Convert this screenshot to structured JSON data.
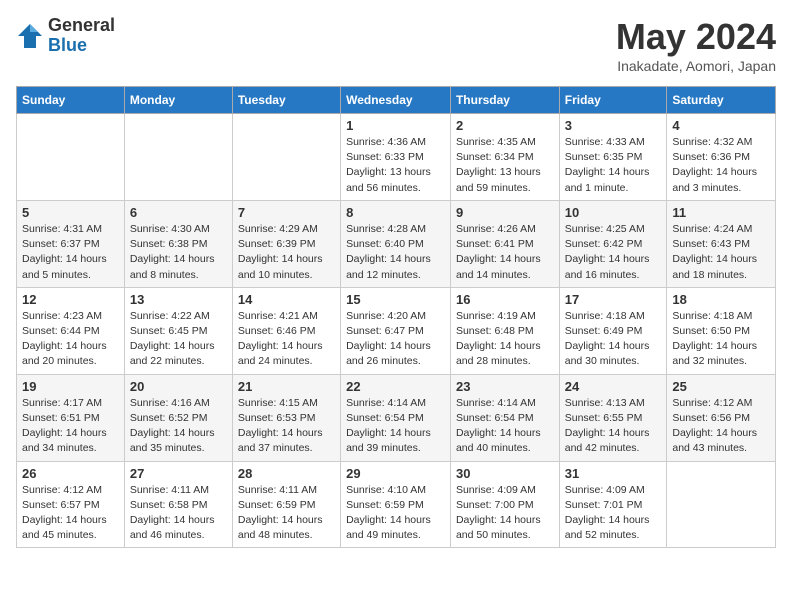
{
  "logo": {
    "general": "General",
    "blue": "Blue"
  },
  "header": {
    "month": "May 2024",
    "location": "Inakadate, Aomori, Japan"
  },
  "weekdays": [
    "Sunday",
    "Monday",
    "Tuesday",
    "Wednesday",
    "Thursday",
    "Friday",
    "Saturday"
  ],
  "weeks": [
    [
      {
        "day": "",
        "sunrise": "",
        "sunset": "",
        "daylight": ""
      },
      {
        "day": "",
        "sunrise": "",
        "sunset": "",
        "daylight": ""
      },
      {
        "day": "",
        "sunrise": "",
        "sunset": "",
        "daylight": ""
      },
      {
        "day": "1",
        "sunrise": "Sunrise: 4:36 AM",
        "sunset": "Sunset: 6:33 PM",
        "daylight": "Daylight: 13 hours and 56 minutes."
      },
      {
        "day": "2",
        "sunrise": "Sunrise: 4:35 AM",
        "sunset": "Sunset: 6:34 PM",
        "daylight": "Daylight: 13 hours and 59 minutes."
      },
      {
        "day": "3",
        "sunrise": "Sunrise: 4:33 AM",
        "sunset": "Sunset: 6:35 PM",
        "daylight": "Daylight: 14 hours and 1 minute."
      },
      {
        "day": "4",
        "sunrise": "Sunrise: 4:32 AM",
        "sunset": "Sunset: 6:36 PM",
        "daylight": "Daylight: 14 hours and 3 minutes."
      }
    ],
    [
      {
        "day": "5",
        "sunrise": "Sunrise: 4:31 AM",
        "sunset": "Sunset: 6:37 PM",
        "daylight": "Daylight: 14 hours and 5 minutes."
      },
      {
        "day": "6",
        "sunrise": "Sunrise: 4:30 AM",
        "sunset": "Sunset: 6:38 PM",
        "daylight": "Daylight: 14 hours and 8 minutes."
      },
      {
        "day": "7",
        "sunrise": "Sunrise: 4:29 AM",
        "sunset": "Sunset: 6:39 PM",
        "daylight": "Daylight: 14 hours and 10 minutes."
      },
      {
        "day": "8",
        "sunrise": "Sunrise: 4:28 AM",
        "sunset": "Sunset: 6:40 PM",
        "daylight": "Daylight: 14 hours and 12 minutes."
      },
      {
        "day": "9",
        "sunrise": "Sunrise: 4:26 AM",
        "sunset": "Sunset: 6:41 PM",
        "daylight": "Daylight: 14 hours and 14 minutes."
      },
      {
        "day": "10",
        "sunrise": "Sunrise: 4:25 AM",
        "sunset": "Sunset: 6:42 PM",
        "daylight": "Daylight: 14 hours and 16 minutes."
      },
      {
        "day": "11",
        "sunrise": "Sunrise: 4:24 AM",
        "sunset": "Sunset: 6:43 PM",
        "daylight": "Daylight: 14 hours and 18 minutes."
      }
    ],
    [
      {
        "day": "12",
        "sunrise": "Sunrise: 4:23 AM",
        "sunset": "Sunset: 6:44 PM",
        "daylight": "Daylight: 14 hours and 20 minutes."
      },
      {
        "day": "13",
        "sunrise": "Sunrise: 4:22 AM",
        "sunset": "Sunset: 6:45 PM",
        "daylight": "Daylight: 14 hours and 22 minutes."
      },
      {
        "day": "14",
        "sunrise": "Sunrise: 4:21 AM",
        "sunset": "Sunset: 6:46 PM",
        "daylight": "Daylight: 14 hours and 24 minutes."
      },
      {
        "day": "15",
        "sunrise": "Sunrise: 4:20 AM",
        "sunset": "Sunset: 6:47 PM",
        "daylight": "Daylight: 14 hours and 26 minutes."
      },
      {
        "day": "16",
        "sunrise": "Sunrise: 4:19 AM",
        "sunset": "Sunset: 6:48 PM",
        "daylight": "Daylight: 14 hours and 28 minutes."
      },
      {
        "day": "17",
        "sunrise": "Sunrise: 4:18 AM",
        "sunset": "Sunset: 6:49 PM",
        "daylight": "Daylight: 14 hours and 30 minutes."
      },
      {
        "day": "18",
        "sunrise": "Sunrise: 4:18 AM",
        "sunset": "Sunset: 6:50 PM",
        "daylight": "Daylight: 14 hours and 32 minutes."
      }
    ],
    [
      {
        "day": "19",
        "sunrise": "Sunrise: 4:17 AM",
        "sunset": "Sunset: 6:51 PM",
        "daylight": "Daylight: 14 hours and 34 minutes."
      },
      {
        "day": "20",
        "sunrise": "Sunrise: 4:16 AM",
        "sunset": "Sunset: 6:52 PM",
        "daylight": "Daylight: 14 hours and 35 minutes."
      },
      {
        "day": "21",
        "sunrise": "Sunrise: 4:15 AM",
        "sunset": "Sunset: 6:53 PM",
        "daylight": "Daylight: 14 hours and 37 minutes."
      },
      {
        "day": "22",
        "sunrise": "Sunrise: 4:14 AM",
        "sunset": "Sunset: 6:54 PM",
        "daylight": "Daylight: 14 hours and 39 minutes."
      },
      {
        "day": "23",
        "sunrise": "Sunrise: 4:14 AM",
        "sunset": "Sunset: 6:54 PM",
        "daylight": "Daylight: 14 hours and 40 minutes."
      },
      {
        "day": "24",
        "sunrise": "Sunrise: 4:13 AM",
        "sunset": "Sunset: 6:55 PM",
        "daylight": "Daylight: 14 hours and 42 minutes."
      },
      {
        "day": "25",
        "sunrise": "Sunrise: 4:12 AM",
        "sunset": "Sunset: 6:56 PM",
        "daylight": "Daylight: 14 hours and 43 minutes."
      }
    ],
    [
      {
        "day": "26",
        "sunrise": "Sunrise: 4:12 AM",
        "sunset": "Sunset: 6:57 PM",
        "daylight": "Daylight: 14 hours and 45 minutes."
      },
      {
        "day": "27",
        "sunrise": "Sunrise: 4:11 AM",
        "sunset": "Sunset: 6:58 PM",
        "daylight": "Daylight: 14 hours and 46 minutes."
      },
      {
        "day": "28",
        "sunrise": "Sunrise: 4:11 AM",
        "sunset": "Sunset: 6:59 PM",
        "daylight": "Daylight: 14 hours and 48 minutes."
      },
      {
        "day": "29",
        "sunrise": "Sunrise: 4:10 AM",
        "sunset": "Sunset: 6:59 PM",
        "daylight": "Daylight: 14 hours and 49 minutes."
      },
      {
        "day": "30",
        "sunrise": "Sunrise: 4:09 AM",
        "sunset": "Sunset: 7:00 PM",
        "daylight": "Daylight: 14 hours and 50 minutes."
      },
      {
        "day": "31",
        "sunrise": "Sunrise: 4:09 AM",
        "sunset": "Sunset: 7:01 PM",
        "daylight": "Daylight: 14 hours and 52 minutes."
      },
      {
        "day": "",
        "sunrise": "",
        "sunset": "",
        "daylight": ""
      }
    ]
  ]
}
